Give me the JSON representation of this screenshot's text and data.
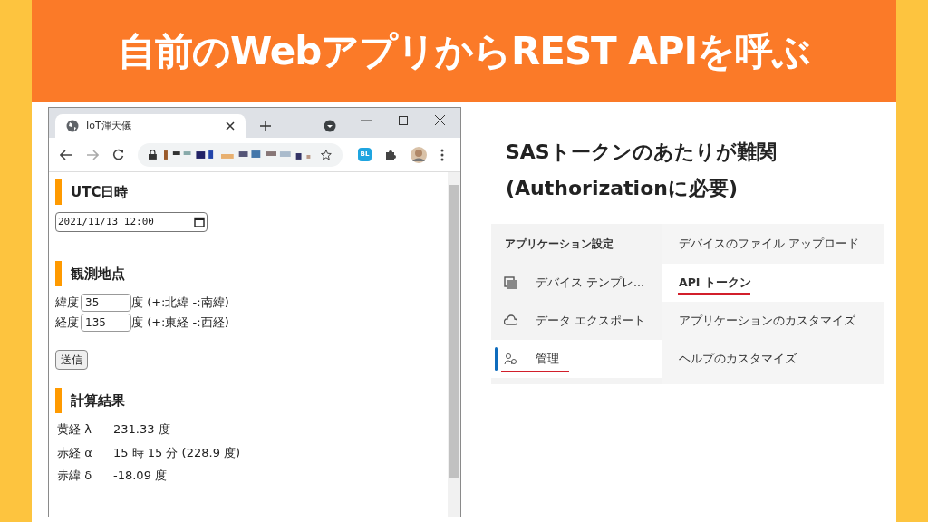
{
  "slide_title": "自前のWebアプリからREST APIを呼ぶ",
  "browser": {
    "tab_title": "IoT渾天儀",
    "extension_badge": "BL"
  },
  "utc": {
    "heading": "UTC日時",
    "value": "2021/11/13 12:00"
  },
  "location": {
    "heading": "観測地点",
    "rows": [
      {
        "label": "緯度",
        "value": "35",
        "unit": "度 (+:北緯 -:南緯)"
      },
      {
        "label": "経度",
        "value": "135",
        "unit": "度 (+:東経 -:西経)"
      }
    ]
  },
  "submit_button": "送信",
  "results": {
    "heading": "計算結果",
    "rows": [
      {
        "label": "黄経 λ",
        "value": "231.33 度"
      },
      {
        "label": "赤経 α",
        "value": "15 時 15 分 (228.9 度)"
      },
      {
        "label": "赤緯 δ",
        "value": "-18.09 度"
      }
    ]
  },
  "note": [
    "SASトークンのあたりが難関",
    "(Authorizationに必要)"
  ],
  "settings": {
    "heading": "アプリケーション設定",
    "menu": [
      {
        "kind": "template",
        "label": "デバイス テンプレ...",
        "selected": false,
        "underlined": false
      },
      {
        "kind": "export",
        "label": "データ エクスポート",
        "selected": false,
        "underlined": false
      },
      {
        "kind": "admin",
        "label": "管理",
        "selected": true,
        "underlined": true
      }
    ],
    "submenu": [
      {
        "label": "デバイスのファイル アップロード",
        "selected": false,
        "underlined": false
      },
      {
        "label": "API トークン",
        "selected": true,
        "underlined": true
      },
      {
        "label": "アプリケーションのカスタマイズ",
        "selected": false,
        "underlined": false
      },
      {
        "label": "ヘルプのカスタマイズ",
        "selected": false,
        "underlined": false
      }
    ]
  }
}
